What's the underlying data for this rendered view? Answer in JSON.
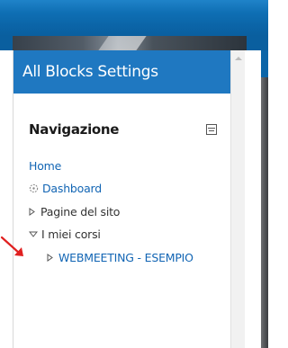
{
  "drawer": {
    "header_title": "All Blocks Settings"
  },
  "navigation": {
    "title": "Navigazione",
    "items": [
      {
        "label": "Home"
      },
      {
        "label": "Dashboard"
      },
      {
        "label": "Pagine del sito"
      },
      {
        "label": "I miei corsi"
      },
      {
        "label": "WEBMEETING - ESEMPIO"
      }
    ]
  },
  "colors": {
    "header_blue": "#1f78c1",
    "link_blue": "#1265b4",
    "annotation_red": "#e02020"
  },
  "icons": {
    "collapse": "collapse-block-icon",
    "dashboard": "dashboard-gauge-icon",
    "expand": "triangle-right-icon",
    "expanded": "triangle-down-icon",
    "annotation": "red-arrow-icon"
  }
}
